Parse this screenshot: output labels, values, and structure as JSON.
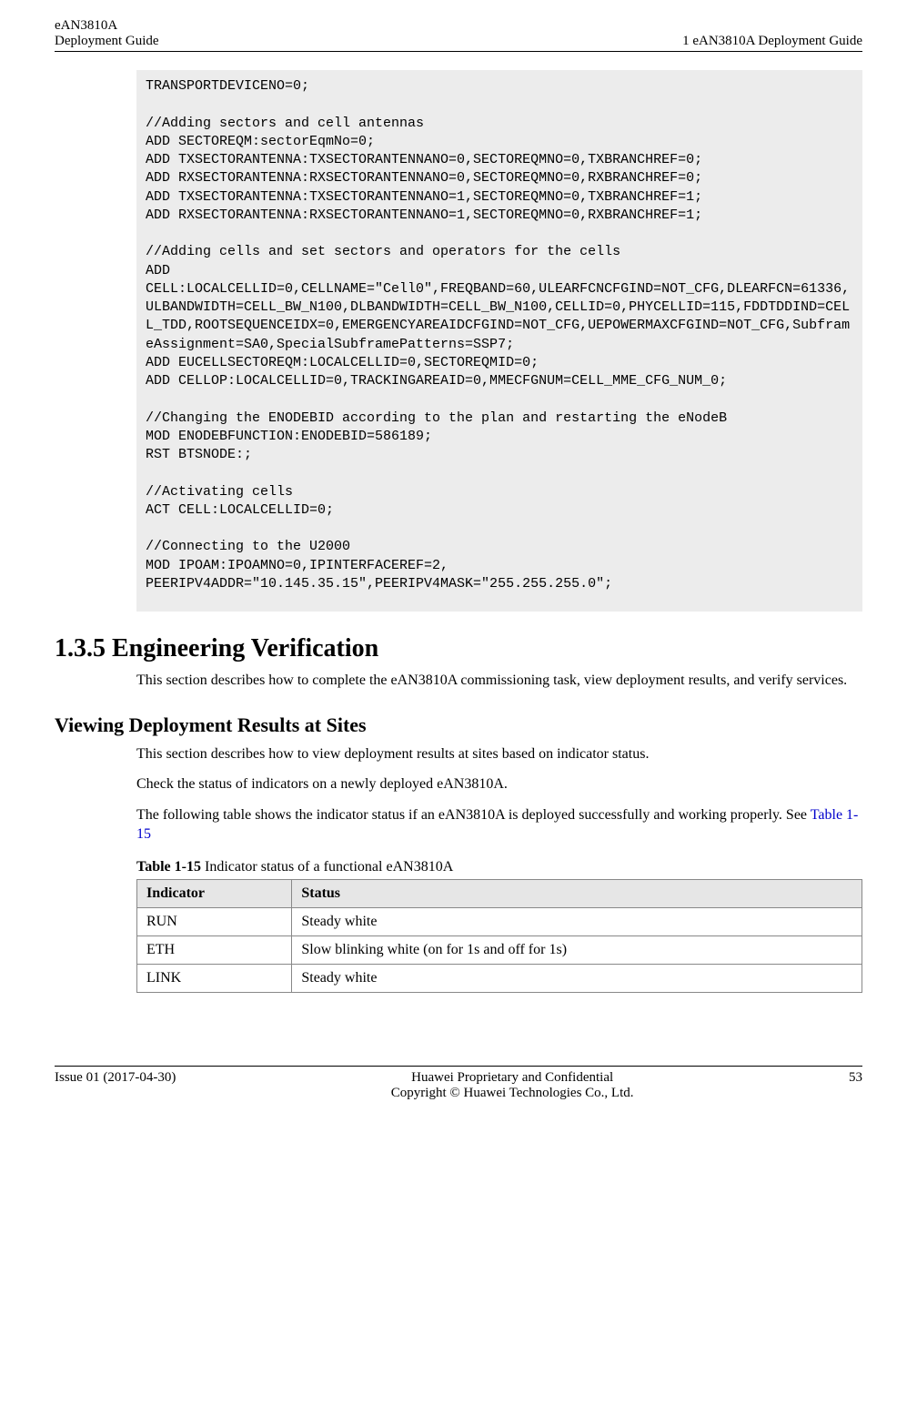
{
  "header": {
    "left_line1": "eAN3810A",
    "left_line2": "Deployment Guide",
    "right": "1 eAN3810A Deployment Guide"
  },
  "code": "TRANSPORTDEVICENO=0;\n\n//Adding sectors and cell antennas\nADD SECTOREQM:sectorEqmNo=0;\nADD TXSECTORANTENNA:TXSECTORANTENNANO=0,SECTOREQMNO=0,TXBRANCHREF=0;\nADD RXSECTORANTENNA:RXSECTORANTENNANO=0,SECTOREQMNO=0,RXBRANCHREF=0;\nADD TXSECTORANTENNA:TXSECTORANTENNANO=1,SECTOREQMNO=0,TXBRANCHREF=1;\nADD RXSECTORANTENNA:RXSECTORANTENNANO=1,SECTOREQMNO=0,RXBRANCHREF=1;\n\n//Adding cells and set sectors and operators for the cells\nADD CELL:LOCALCELLID=0,CELLNAME=\"Cell0\",FREQBAND=60,ULEARFCNCFGIND=NOT_CFG,DLEARFCN=61336,ULBANDWIDTH=CELL_BW_N100,DLBANDWIDTH=CELL_BW_N100,CELLID=0,PHYCELLID=115,FDDTDDIND=CELL_TDD,ROOTSEQUENCEIDX=0,EMERGENCYAREAIDCFGIND=NOT_CFG,UEPOWERMAXCFGIND=NOT_CFG,SubframeAssignment=SA0,SpecialSubframePatterns=SSP7;\nADD EUCELLSECTOREQM:LOCALCELLID=0,SECTOREQMID=0;\nADD CELLOP:LOCALCELLID=0,TRACKINGAREAID=0,MMECFGNUM=CELL_MME_CFG_NUM_0;\n\n//Changing the ENODEBID according to the plan and restarting the eNodeB\nMOD ENODEBFUNCTION:ENODEBID=586189;\nRST BTSNODE:;\n\n//Activating cells\nACT CELL:LOCALCELLID=0;\n\n//Connecting to the U2000\nMOD IPOAM:IPOAMNO=0,IPINTERFACEREF=2,\nPEERIPV4ADDR=\"10.145.35.15\",PEERIPV4MASK=\"255.255.255.0\";",
  "section_1_3_5": {
    "title": "1.3.5 Engineering Verification",
    "intro": "This section describes how to complete the eAN3810A commissioning task, view deployment results, and verify services."
  },
  "viewing": {
    "title": "Viewing Deployment Results at Sites",
    "p1": "This section describes how to view deployment results at sites based on indicator status.",
    "p2": "Check the status of indicators on a newly deployed eAN3810A.",
    "p3_pre": "The following table shows the indicator status if an eAN3810A is deployed successfully and working properly. See ",
    "p3_link": "Table 1-15"
  },
  "table": {
    "caption_bold": "Table 1-15",
    "caption_rest": " Indicator status of a functional eAN3810A",
    "headers": [
      "Indicator",
      "Status"
    ],
    "rows": [
      [
        "RUN",
        "Steady white"
      ],
      [
        "ETH",
        "Slow blinking white (on for 1s and off for 1s)"
      ],
      [
        "LINK",
        "Steady white"
      ]
    ]
  },
  "footer": {
    "left": "Issue 01 (2017-04-30)",
    "center_line1": "Huawei Proprietary and Confidential",
    "center_line2": "Copyright © Huawei Technologies Co., Ltd.",
    "right": "53"
  }
}
